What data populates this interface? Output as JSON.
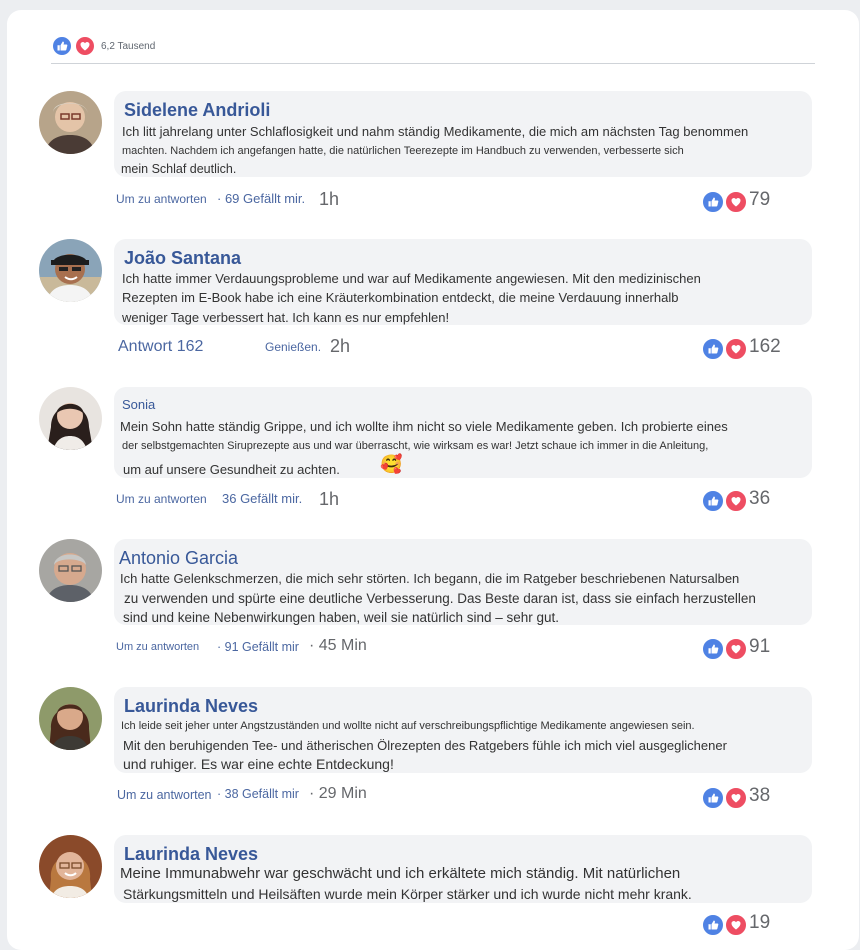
{
  "header": {
    "reaction_count": "6,2 Tausend"
  },
  "comments": [
    {
      "name": "Sidelene Andrioli",
      "lines": [
        "Ich litt jahrelang unter Schlaflosigkeit und nahm ständig Medikamente, die mich am nächsten Tag benommen",
        "machten. Nachdem ich angefangen hatte, die natürlichen Teerezepte im Handbuch zu verwenden, verbesserte sich",
        "mein Schlaf deutlich."
      ],
      "reply": "Um zu antworten",
      "likes": "· 69 Gefällt mir.",
      "time": "1h",
      "reactions": "79"
    },
    {
      "name": "João Santana",
      "lines": [
        "Ich hatte immer Verdauungsprobleme und war auf Medikamente angewiesen. Mit den medizinischen",
        "Rezepten im E-Book habe ich eine Kräuterkombination entdeckt, die meine Verdauung innerhalb",
        "weniger Tage verbessert hat. Ich kann es nur empfehlen!"
      ],
      "reply": "Antwort 162",
      "likes": "Genießen.",
      "time": "2h",
      "reactions": "162"
    },
    {
      "name": "Sonia",
      "lines": [
        "Mein Sohn hatte ständig Grippe, und ich wollte ihm nicht so viele Medikamente geben. Ich probierte eines",
        "der selbstgemachten Siruprezepte aus und war überrascht, wie wirksam es war! Jetzt schaue ich immer in die Anleitung,",
        "um auf unsere Gesundheit zu achten."
      ],
      "emoji": "🥰",
      "reply": "Um zu antworten",
      "likes": "36 Gefällt mir.",
      "time": "1h",
      "reactions": "36"
    },
    {
      "name": "Antonio Garcia",
      "lines": [
        "Ich hatte Gelenkschmerzen, die mich sehr störten. Ich begann, die im Ratgeber beschriebenen Natursalben",
        "zu verwenden und spürte eine deutliche Verbesserung. Das Beste daran ist, dass sie einfach herzustellen",
        "sind und keine Nebenwirkungen haben, weil sie natürlich sind – sehr gut."
      ],
      "reply": "Um zu antworten",
      "likes": "· 91 Gefällt mir",
      "time": "· 45 Min",
      "reactions": "91"
    },
    {
      "name": "Laurinda Neves",
      "lines": [
        "Ich leide seit jeher unter Angstzuständen und wollte nicht auf verschreibungspflichtige Medikamente angewiesen sein.",
        "Mit den beruhigenden Tee- und ätherischen Ölrezepten des Ratgebers fühle ich mich viel ausgeglichener",
        "und ruhiger. Es war eine echte Entdeckung!"
      ],
      "reply": "Um zu antworten",
      "likes": "· 38 Gefällt mir",
      "time": "· 29 Min",
      "reactions": "38"
    },
    {
      "name": "Laurinda Neves",
      "lines": [
        "Meine Immunabwehr war geschwächt und ich erkältete mich ständig. Mit natürlichen",
        "Stärkungsmitteln und Heilsäften wurde mein Körper stärker und ich wurde nicht mehr krank."
      ],
      "reactions": "19"
    }
  ],
  "icons": {
    "like": "thumbs-up-icon",
    "love": "heart-icon"
  },
  "colors": {
    "like": "#4f82e4",
    "love": "#ee4d62",
    "name": "#385898",
    "meta": "#4b67a1"
  }
}
